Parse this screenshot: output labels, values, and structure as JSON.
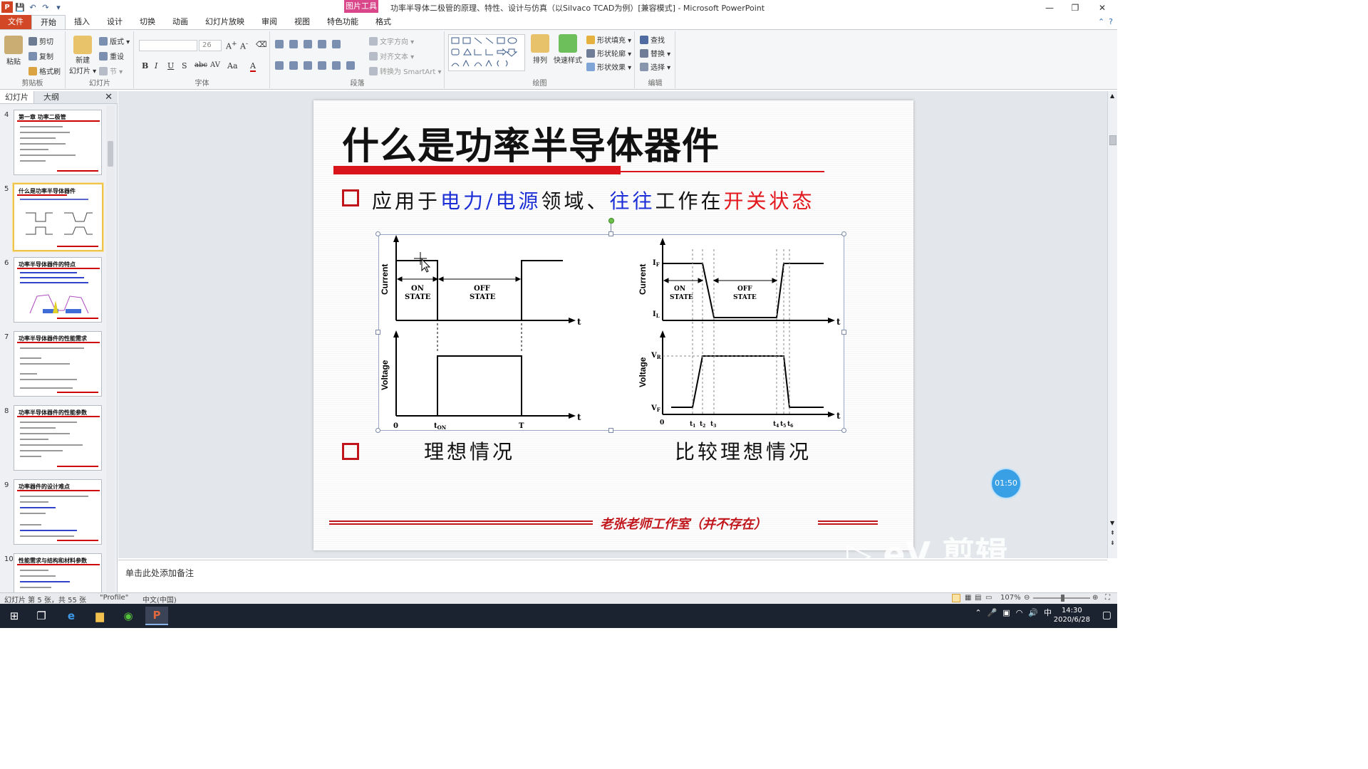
{
  "window": {
    "title": "功率半导体二极管的原理、特性、设计与仿真（以Silvaco TCAD为例）[兼容模式] - Microsoft PowerPoint",
    "context_tab_group": "图片工具",
    "min_glyph": "—",
    "restore_glyph": "❐",
    "close_glyph": "✕"
  },
  "qat": {
    "app_logo": "P",
    "save": "💾",
    "undo": "↶",
    "redo": "↷",
    "customize": "▾"
  },
  "ribbon_tabs": [
    "文件",
    "开始",
    "插入",
    "设计",
    "切换",
    "动画",
    "幻灯片放映",
    "审阅",
    "视图",
    "特色功能",
    "格式"
  ],
  "ribbon": {
    "clipboard": {
      "paste": "粘贴",
      "cut": "剪切",
      "copy": "复制",
      "format_painter": "格式刷",
      "label": "剪贴板"
    },
    "slides": {
      "new_slide": "新建\n幻灯片",
      "new_slide_line1": "新建",
      "new_slide_line2": "幻灯片 ▾",
      "layout": "版式 ▾",
      "reset": "重设",
      "section": "节 ▾",
      "label": "幻灯片"
    },
    "font": {
      "font_name": "",
      "font_size": "26",
      "label": "字体",
      "bold": "B",
      "italic": "I",
      "underline": "U",
      "shadow": "S",
      "strike": "abc",
      "spacing": "AV",
      "case": "Aa",
      "color": "A"
    },
    "paragraph": {
      "text_direction": "文字方向 ▾",
      "align_text": "对齐文本 ▾",
      "smartart": "转换为 SmartArt ▾",
      "label": "段落"
    },
    "drawing": {
      "arrange": "排列",
      "quick_styles": "快速样式",
      "shape_fill": "形状填充 ▾",
      "shape_outline": "形状轮廓 ▾",
      "shape_effects": "形状效果 ▾",
      "label": "绘图"
    },
    "editing": {
      "find": "查找",
      "replace": "替换 ▾",
      "select": "选择 ▾",
      "label": "编辑"
    }
  },
  "left_panel": {
    "tabs": [
      "幻灯片",
      "大纲"
    ],
    "close": "✕",
    "thumbnails": [
      {
        "num": "4",
        "title": "第一章 功率二极管",
        "selected": false
      },
      {
        "num": "5",
        "title": "什么是功率半导体器件",
        "selected": true
      },
      {
        "num": "6",
        "title": "功率半导体器件的特点",
        "selected": false
      },
      {
        "num": "7",
        "title": "功率半导体器件的性能需求",
        "selected": false
      },
      {
        "num": "8",
        "title": "功率半导体器件的性能参数",
        "selected": false
      },
      {
        "num": "9",
        "title": "功率器件的设计难点",
        "selected": false
      },
      {
        "num": "10",
        "title": "性能需求与结构和材料参数",
        "selected": false
      }
    ]
  },
  "slide": {
    "title": "什么是功率半导体器件",
    "bullet1": {
      "seg1": "应用于",
      "seg2": "电力/电源",
      "seg3": "领域、",
      "seg4": "往往",
      "seg5": "工作在",
      "seg6": "开关状态"
    },
    "bullet2_left": "理想情况",
    "bullet2_right": "比较理想情况",
    "footer": "老张老师工作室（并不存在）",
    "figure": {
      "left": {
        "y_top": "Current",
        "y_bottom": "Voltage",
        "on_state": [
          "ON",
          "STATE"
        ],
        "off_state": [
          "OFF",
          "STATE"
        ],
        "t": "t",
        "zero": "0",
        "t_on": "t",
        "t_on_sub": "ON",
        "T": "T"
      },
      "right": {
        "y_top": "Current",
        "y_bottom": "Voltage",
        "IF": "I",
        "IF_sub": "F",
        "IL": "I",
        "IL_sub": "L",
        "VR": "V",
        "VR_sub": "R",
        "VF": "V",
        "VF_sub": "F",
        "on_state": [
          "ON",
          "STATE"
        ],
        "off_state": [
          "OFF",
          "STATE"
        ],
        "t": "t",
        "zero": "0",
        "ticks": [
          [
            "t",
            "1"
          ],
          [
            "t",
            "2"
          ],
          [
            "t",
            "3"
          ],
          [
            "t",
            "4"
          ],
          [
            "t",
            "5"
          ],
          [
            "t",
            "6"
          ]
        ]
      }
    }
  },
  "notes": {
    "placeholder": "单击此处添加备注"
  },
  "status_bar": {
    "slide_info": "幻灯片 第 5 张，共 55 张",
    "theme": "\"Profile\"",
    "language": "中文(中国)",
    "zoom": "107%"
  },
  "timer": "01:50",
  "watermark": "▷ eV 剪辑",
  "taskbar": {
    "ime": "中",
    "time": "14:30",
    "date": "2020/6/28"
  },
  "colors": {
    "accent_red": "#d9141a",
    "blue_text": "#1c2fd6",
    "file_tab": "#d24726",
    "context_tab": "#d9468a"
  }
}
